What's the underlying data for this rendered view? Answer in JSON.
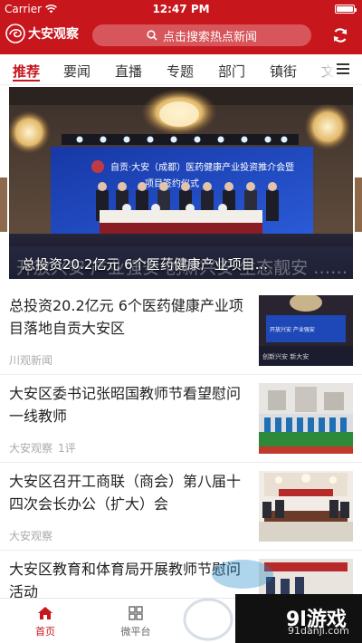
{
  "status": {
    "carrier": "Carrier",
    "time": "12:47 PM"
  },
  "header": {
    "app_name": "大安观察",
    "search_placeholder": "点击搜索热点新闻"
  },
  "tabs": [
    "推荐",
    "要闻",
    "直播",
    "专题",
    "部门",
    "镇街",
    "文"
  ],
  "banner": {
    "caption": "总投资20.2亿元 6个医药健康产业项目...",
    "sign_line1": "自贡·大安（成都）医药健康产业投资推介会暨",
    "sign_line2": "项目签约仪式",
    "slogan": "开放兴安 产业强安 创新兴安 生态靓安 …… 新大安"
  },
  "news": [
    {
      "title": "总投资20.2亿元 6个医药健康产业项目落地自贡大安区",
      "source": "川观新闻",
      "comments": ""
    },
    {
      "title": "大安区委书记张昭国教师节看望慰问一线教师",
      "source": "大安观察",
      "comments": "1评"
    },
    {
      "title": "大安区召开工商联（商会）第八届十四次会长办公（扩大）会",
      "source": "大安观察",
      "comments": ""
    },
    {
      "title": "大安区教育和体育局开展教师节慰问活动",
      "source": "",
      "comments": ""
    }
  ],
  "thumb1": {
    "line1": "开放兴安 产业强安",
    "line2": "创新兴安 新大安"
  },
  "tabbar": [
    {
      "label": "首页"
    },
    {
      "label": "微平台"
    }
  ],
  "watermark": {
    "brand": "9l游戏",
    "url": "91danji.com"
  },
  "colors": {
    "brand_red": "#c8161d",
    "text_dark": "#222222",
    "meta_gray": "#aaaaaa"
  }
}
